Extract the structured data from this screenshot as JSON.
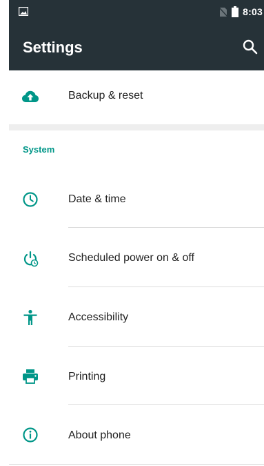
{
  "status_bar": {
    "time": "8:03",
    "icons": [
      "image-notification-icon",
      "no-sim-icon",
      "battery-icon"
    ]
  },
  "app_bar": {
    "title": "Settings",
    "search_icon": "search-icon"
  },
  "accent_color": "#009688",
  "items_top": [
    {
      "label": "Backup & reset",
      "icon": "cloud-upload-icon"
    }
  ],
  "section": {
    "title": "System"
  },
  "items_system": [
    {
      "label": "Date & time",
      "icon": "clock-icon"
    },
    {
      "label": "Scheduled power on & off",
      "icon": "power-schedule-icon"
    },
    {
      "label": "Accessibility",
      "icon": "accessibility-icon"
    },
    {
      "label": "Printing",
      "icon": "printer-icon"
    },
    {
      "label": "About phone",
      "icon": "info-icon"
    }
  ]
}
